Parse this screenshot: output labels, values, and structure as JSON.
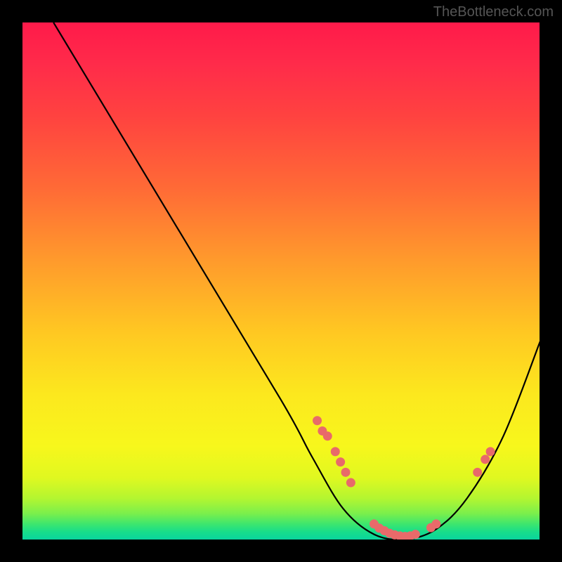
{
  "watermark": "TheBottleneck.com",
  "chart_data": {
    "type": "line",
    "title": "",
    "xlabel": "",
    "ylabel": "",
    "xlim": [
      0,
      100
    ],
    "ylim": [
      0,
      100
    ],
    "gradient_stops": [
      {
        "pos": 0,
        "hex": "#ff1a4a"
      },
      {
        "pos": 18,
        "hex": "#ff4240"
      },
      {
        "pos": 46,
        "hex": "#ff9a2c"
      },
      {
        "pos": 72,
        "hex": "#fce81e"
      },
      {
        "pos": 92,
        "hex": "#b4f630"
      },
      {
        "pos": 100,
        "hex": "#0ad49e"
      }
    ],
    "curve_points": [
      {
        "x": 6,
        "y": 100
      },
      {
        "x": 30,
        "y": 60
      },
      {
        "x": 50,
        "y": 27
      },
      {
        "x": 56,
        "y": 16
      },
      {
        "x": 62,
        "y": 6
      },
      {
        "x": 68,
        "y": 1
      },
      {
        "x": 74,
        "y": 0
      },
      {
        "x": 80,
        "y": 2
      },
      {
        "x": 86,
        "y": 8
      },
      {
        "x": 93,
        "y": 20
      },
      {
        "x": 100,
        "y": 38
      }
    ],
    "marker_points": [
      {
        "x": 57,
        "y": 23
      },
      {
        "x": 58,
        "y": 21
      },
      {
        "x": 59,
        "y": 20
      },
      {
        "x": 60.5,
        "y": 17
      },
      {
        "x": 61.5,
        "y": 15
      },
      {
        "x": 62.5,
        "y": 13
      },
      {
        "x": 63.5,
        "y": 11
      },
      {
        "x": 68,
        "y": 3
      },
      {
        "x": 69,
        "y": 2.2
      },
      {
        "x": 70,
        "y": 1.7
      },
      {
        "x": 71,
        "y": 1.2
      },
      {
        "x": 72,
        "y": 0.9
      },
      {
        "x": 73,
        "y": 0.7
      },
      {
        "x": 74,
        "y": 0.6
      },
      {
        "x": 75,
        "y": 0.7
      },
      {
        "x": 76,
        "y": 1.0
      },
      {
        "x": 79,
        "y": 2.3
      },
      {
        "x": 80,
        "y": 3.0
      },
      {
        "x": 88,
        "y": 13
      },
      {
        "x": 89.5,
        "y": 15.5
      },
      {
        "x": 90.5,
        "y": 17
      }
    ],
    "marker_color": "#e86a6a",
    "line_color": "#000000"
  }
}
